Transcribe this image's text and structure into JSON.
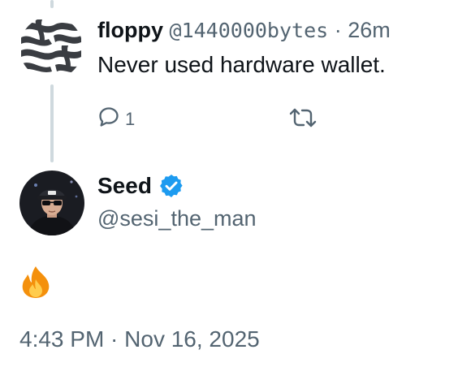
{
  "reply": {
    "name": "floppy",
    "handle": "@1440000bytes",
    "separator": "·",
    "time": "26m",
    "text": "Never used hardware wallet.",
    "reply_count": "1"
  },
  "tweet": {
    "author_name": "Seed",
    "author_handle": "@sesi_the_man",
    "text": "🔥",
    "timestamp": "4:43 PM · Nov 16, 2025"
  },
  "icons": {
    "reply": "speech-bubble-icon",
    "retweet": "retweet-icon",
    "verified": "verified-badge-icon"
  },
  "colors": {
    "verified": "#1d9bf0",
    "secondary_text": "#536471",
    "primary_text": "#0f1419",
    "thread_line": "#cfd9de"
  }
}
